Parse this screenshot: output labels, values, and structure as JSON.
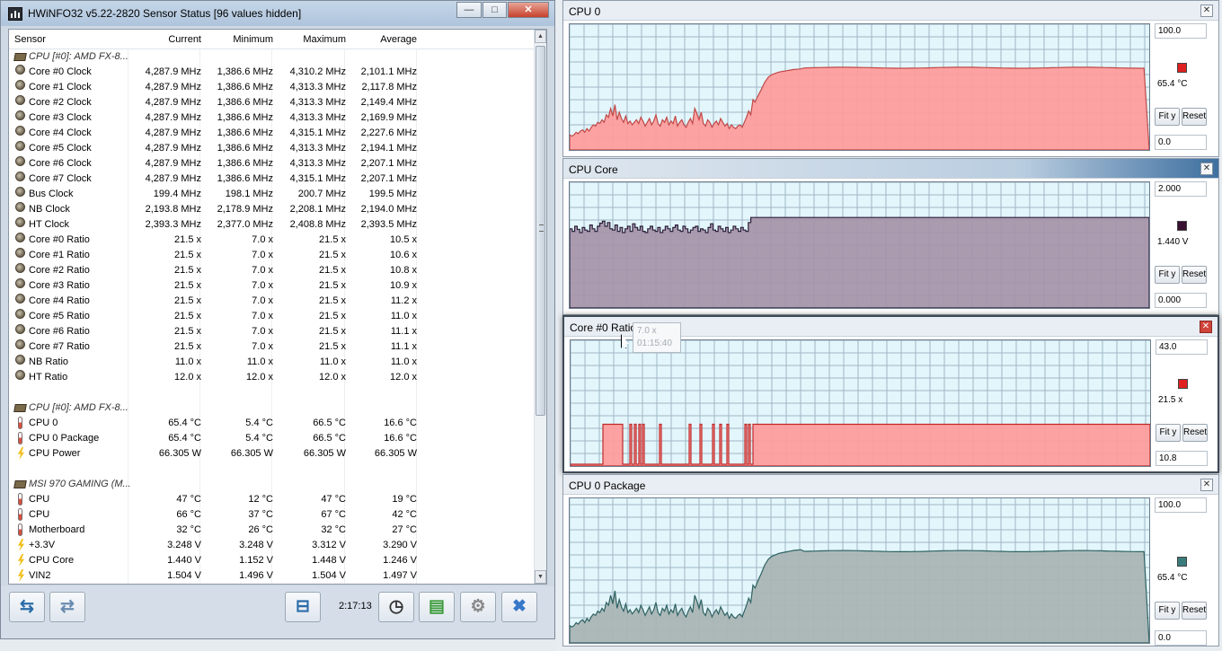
{
  "window": {
    "title": "HWiNFO32 v5.22-2820 Sensor Status [96 values hidden]",
    "min_label": "—",
    "max_label": "□",
    "close_label": "✕"
  },
  "table": {
    "headers": {
      "sensor": "Sensor",
      "current": "Current",
      "minimum": "Minimum",
      "maximum": "Maximum",
      "average": "Average"
    },
    "rows": [
      {
        "type": "header",
        "icon": "chip-icon",
        "name": "CPU [#0]: AMD FX-8..."
      },
      {
        "type": "clock",
        "icon": "clock-sensor-icon",
        "name": "Core #0 Clock",
        "current": "4,287.9 MHz",
        "minimum": "1,386.6 MHz",
        "maximum": "4,310.2 MHz",
        "average": "2,101.1 MHz"
      },
      {
        "type": "clock",
        "icon": "clock-sensor-icon",
        "name": "Core #1 Clock",
        "current": "4,287.9 MHz",
        "minimum": "1,386.6 MHz",
        "maximum": "4,313.3 MHz",
        "average": "2,117.8 MHz"
      },
      {
        "type": "clock",
        "icon": "clock-sensor-icon",
        "name": "Core #2 Clock",
        "current": "4,287.9 MHz",
        "minimum": "1,386.6 MHz",
        "maximum": "4,313.3 MHz",
        "average": "2,149.4 MHz"
      },
      {
        "type": "clock",
        "icon": "clock-sensor-icon",
        "name": "Core #3 Clock",
        "current": "4,287.9 MHz",
        "minimum": "1,386.6 MHz",
        "maximum": "4,313.3 MHz",
        "average": "2,169.9 MHz"
      },
      {
        "type": "clock",
        "icon": "clock-sensor-icon",
        "name": "Core #4 Clock",
        "current": "4,287.9 MHz",
        "minimum": "1,386.6 MHz",
        "maximum": "4,315.1 MHz",
        "average": "2,227.6 MHz"
      },
      {
        "type": "clock",
        "icon": "clock-sensor-icon",
        "name": "Core #5 Clock",
        "current": "4,287.9 MHz",
        "minimum": "1,386.6 MHz",
        "maximum": "4,313.3 MHz",
        "average": "2,194.1 MHz"
      },
      {
        "type": "clock",
        "icon": "clock-sensor-icon",
        "name": "Core #6 Clock",
        "current": "4,287.9 MHz",
        "minimum": "1,386.6 MHz",
        "maximum": "4,313.3 MHz",
        "average": "2,207.1 MHz"
      },
      {
        "type": "clock",
        "icon": "clock-sensor-icon",
        "name": "Core #7 Clock",
        "current": "4,287.9 MHz",
        "minimum": "1,386.6 MHz",
        "maximum": "4,315.1 MHz",
        "average": "2,207.1 MHz"
      },
      {
        "type": "clock",
        "icon": "clock-sensor-icon",
        "name": "Bus Clock",
        "current": "199.4 MHz",
        "minimum": "198.1 MHz",
        "maximum": "200.7 MHz",
        "average": "199.5 MHz"
      },
      {
        "type": "clock",
        "icon": "clock-sensor-icon",
        "name": "NB Clock",
        "current": "2,193.8 MHz",
        "minimum": "2,178.9 MHz",
        "maximum": "2,208.1 MHz",
        "average": "2,194.0 MHz"
      },
      {
        "type": "clock",
        "icon": "clock-sensor-icon",
        "name": "HT Clock",
        "current": "2,393.3 MHz",
        "minimum": "2,377.0 MHz",
        "maximum": "2,408.8 MHz",
        "average": "2,393.5 MHz"
      },
      {
        "type": "clock",
        "icon": "clock-sensor-icon",
        "name": "Core #0 Ratio",
        "current": "21.5 x",
        "minimum": "7.0 x",
        "maximum": "21.5 x",
        "average": "10.5 x"
      },
      {
        "type": "clock",
        "icon": "clock-sensor-icon",
        "name": "Core #1 Ratio",
        "current": "21.5 x",
        "minimum": "7.0 x",
        "maximum": "21.5 x",
        "average": "10.6 x"
      },
      {
        "type": "clock",
        "icon": "clock-sensor-icon",
        "name": "Core #2 Ratio",
        "current": "21.5 x",
        "minimum": "7.0 x",
        "maximum": "21.5 x",
        "average": "10.8 x"
      },
      {
        "type": "clock",
        "icon": "clock-sensor-icon",
        "name": "Core #3 Ratio",
        "current": "21.5 x",
        "minimum": "7.0 x",
        "maximum": "21.5 x",
        "average": "10.9 x"
      },
      {
        "type": "clock",
        "icon": "clock-sensor-icon",
        "name": "Core #4 Ratio",
        "current": "21.5 x",
        "minimum": "7.0 x",
        "maximum": "21.5 x",
        "average": "11.2 x"
      },
      {
        "type": "clock",
        "icon": "clock-sensor-icon",
        "name": "Core #5 Ratio",
        "current": "21.5 x",
        "minimum": "7.0 x",
        "maximum": "21.5 x",
        "average": "11.0 x"
      },
      {
        "type": "clock",
        "icon": "clock-sensor-icon",
        "name": "Core #6 Ratio",
        "current": "21.5 x",
        "minimum": "7.0 x",
        "maximum": "21.5 x",
        "average": "11.1 x"
      },
      {
        "type": "clock",
        "icon": "clock-sensor-icon",
        "name": "Core #7 Ratio",
        "current": "21.5 x",
        "minimum": "7.0 x",
        "maximum": "21.5 x",
        "average": "11.1 x"
      },
      {
        "type": "clock",
        "icon": "clock-sensor-icon",
        "name": "NB Ratio",
        "current": "11.0 x",
        "minimum": "11.0 x",
        "maximum": "11.0 x",
        "average": "11.0 x"
      },
      {
        "type": "clock",
        "icon": "clock-sensor-icon",
        "name": "HT Ratio",
        "current": "12.0 x",
        "minimum": "12.0 x",
        "maximum": "12.0 x",
        "average": "12.0 x"
      },
      {
        "type": "blank"
      },
      {
        "type": "header",
        "icon": "chip-icon",
        "name": "CPU [#0]: AMD FX-8..."
      },
      {
        "type": "therm",
        "icon": "thermometer-icon",
        "name": "CPU 0",
        "current": "65.4 °C",
        "minimum": "5.4 °C",
        "maximum": "66.5 °C",
        "average": "16.6 °C"
      },
      {
        "type": "therm",
        "icon": "thermometer-icon",
        "name": "CPU 0 Package",
        "current": "65.4 °C",
        "minimum": "5.4 °C",
        "maximum": "66.5 °C",
        "average": "16.6 °C"
      },
      {
        "type": "bolt",
        "icon": "power-bolt-icon",
        "name": "CPU Power",
        "current": "66.305 W",
        "minimum": "66.305 W",
        "maximum": "66.305 W",
        "average": "66.305 W"
      },
      {
        "type": "blank"
      },
      {
        "type": "header",
        "icon": "chip-icon",
        "name": "MSI 970 GAMING (M..."
      },
      {
        "type": "therm",
        "icon": "thermometer-icon",
        "name": "CPU",
        "current": "47 °C",
        "minimum": "12 °C",
        "maximum": "47 °C",
        "average": "19 °C"
      },
      {
        "type": "therm",
        "icon": "thermometer-icon",
        "name": "CPU",
        "current": "66 °C",
        "minimum": "37 °C",
        "maximum": "67 °C",
        "average": "42 °C"
      },
      {
        "type": "therm",
        "icon": "thermometer-icon",
        "name": "Motherboard",
        "current": "32 °C",
        "minimum": "26 °C",
        "maximum": "32 °C",
        "average": "27 °C"
      },
      {
        "type": "bolt",
        "icon": "voltage-bolt-icon",
        "name": "+3.3V",
        "current": "3.248 V",
        "minimum": "3.248 V",
        "maximum": "3.312 V",
        "average": "3.290 V"
      },
      {
        "type": "bolt",
        "icon": "voltage-bolt-icon",
        "name": "CPU Core",
        "current": "1.440 V",
        "minimum": "1.152 V",
        "maximum": "1.448 V",
        "average": "1.246 V"
      },
      {
        "type": "bolt",
        "icon": "voltage-bolt-icon",
        "name": "VIN2",
        "current": "1.504 V",
        "minimum": "1.496 V",
        "maximum": "1.504 V",
        "average": "1.497 V"
      }
    ]
  },
  "toolbar": {
    "elapsed": "2:17:13"
  },
  "graphs": [
    {
      "title": "CPU 0",
      "max": "100.0",
      "min": "0.0",
      "current": "65.4 °C",
      "color": "#e02020",
      "fill": "#ff9a9a",
      "stroke": "#c04848",
      "fit_label": "Fit y",
      "reset_label": "Reset",
      "series": {
        "ymax": 100,
        "early": [
          12,
          11,
          12,
          14,
          13,
          15,
          16,
          14,
          17,
          15,
          18,
          20,
          19,
          22,
          21,
          24,
          22,
          28,
          26,
          33,
          27,
          36,
          24,
          30,
          25,
          22,
          27,
          21,
          23,
          20,
          22,
          24,
          21,
          26,
          23,
          19,
          22,
          25,
          20,
          23,
          28,
          21,
          19,
          24,
          22,
          26,
          20,
          23,
          21,
          27,
          19,
          22,
          24,
          20,
          18,
          22,
          25,
          21,
          33,
          29,
          24,
          30,
          21,
          19,
          24,
          22,
          18,
          21,
          23,
          20,
          25,
          22,
          19,
          21,
          17,
          20,
          18,
          17,
          19,
          20,
          18,
          22,
          26,
          31,
          28,
          40,
          38,
          42
        ]
      }
    },
    {
      "title": "CPU Core",
      "max": "2.000",
      "min": "0.000",
      "current": "1.440 V",
      "color": "#3a1030",
      "fill": "#a593a8",
      "stroke": "#2a1f3a",
      "fit_label": "Fit y",
      "reset_label": "Reset",
      "series": {
        "ymax": 2.0,
        "early": [
          1.26,
          1.22,
          1.3,
          1.25,
          1.2,
          1.28,
          1.24,
          1.22,
          1.32,
          1.26,
          1.22,
          1.3,
          1.35,
          1.38,
          1.3,
          1.36,
          1.26,
          1.24,
          1.32,
          1.22,
          1.28,
          1.2,
          1.26,
          1.3,
          1.22,
          1.34,
          1.28,
          1.24,
          1.3,
          1.22,
          1.2,
          1.26,
          1.3,
          1.24,
          1.22,
          1.28,
          1.2,
          1.24,
          1.3,
          1.26,
          1.22,
          1.28,
          1.32,
          1.24,
          1.22,
          1.3,
          1.26,
          1.2,
          1.24,
          1.28,
          1.3,
          1.22,
          1.26,
          1.24,
          1.2,
          1.28,
          1.34,
          1.24,
          1.22,
          1.3,
          1.26,
          1.22,
          1.28,
          1.2,
          1.24,
          1.3,
          1.26,
          1.22,
          1.28,
          1.24,
          1.22,
          1.36,
          1.44
        ]
      }
    },
    {
      "title": "Core #0 Ratio",
      "max": "43.0",
      "min": "10.8",
      "current": "21.5 x",
      "color": "#e02020",
      "fill": "#ff9a9a",
      "stroke": "#c02828",
      "fit_label": "Fit y",
      "reset_label": "Reset",
      "tooltip_value": "7.0 x",
      "tooltip_time": "01:15:40"
    },
    {
      "title": "CPU 0 Package",
      "max": "100.0",
      "min": "0.0",
      "current": "65.4 °C",
      "color": "#3a7c7c",
      "fill": "#a8b3b3",
      "stroke": "#2e6262",
      "fit_label": "Fit y",
      "reset_label": "Reset"
    }
  ]
}
